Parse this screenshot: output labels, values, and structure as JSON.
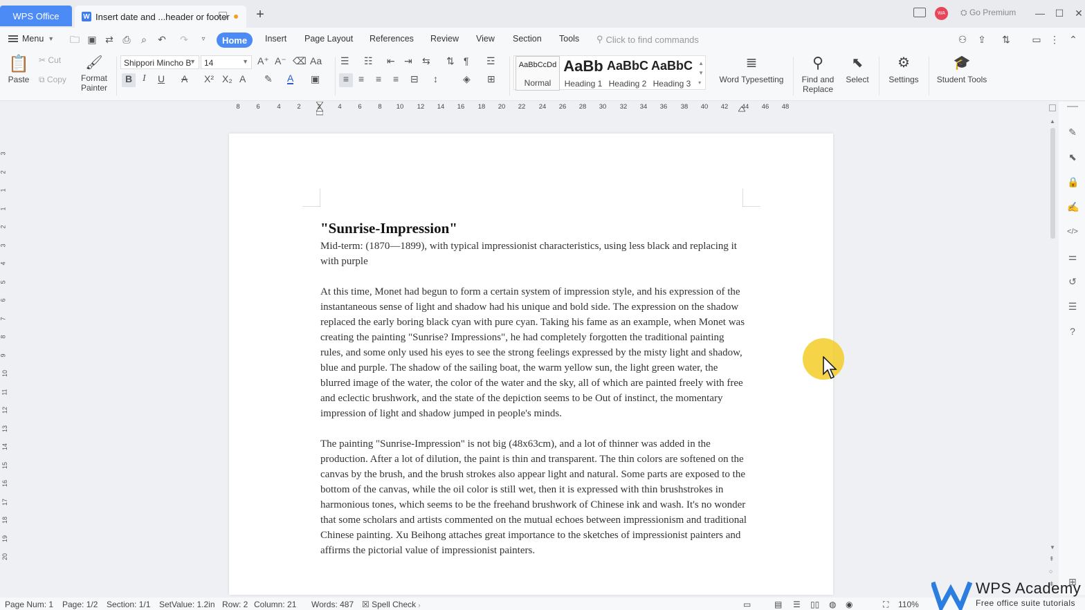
{
  "titlebar": {
    "app_name": "WPS Office",
    "doc_tab": "Insert date and ...header or footer",
    "new_tab": "+",
    "avatar_initials": "WA",
    "go_premium": "Go Premium"
  },
  "menubar": {
    "menu_label": "Menu",
    "tabs": [
      "Home",
      "Insert",
      "Page Layout",
      "References",
      "Review",
      "View",
      "Section",
      "Tools"
    ],
    "active_tab": "Home",
    "search_placeholder": "Click to find commands"
  },
  "ribbon": {
    "paste": "Paste",
    "cut": "Cut",
    "copy": "Copy",
    "format_painter_1": "Format",
    "format_painter_2": "Painter",
    "font_name": "Shippori Mincho B",
    "font_size": "14",
    "styles": [
      {
        "preview": "AaBbCcDd",
        "name": "Normal"
      },
      {
        "preview": "AaBb",
        "name": "Heading 1"
      },
      {
        "preview": "AaBbC",
        "name": "Heading 2"
      },
      {
        "preview": "AaBbC",
        "name": "Heading 3"
      }
    ],
    "word_typesetting": "Word Typesetting",
    "find_replace_1": "Find and",
    "find_replace_2": "Replace",
    "select": "Select",
    "settings": "Settings",
    "student_tools": "Student Tools"
  },
  "ruler": {
    "ticks": [
      "8",
      "6",
      "4",
      "2",
      "2",
      "4",
      "6",
      "8",
      "10",
      "12",
      "14",
      "16",
      "18",
      "20",
      "22",
      "24",
      "26",
      "28",
      "30",
      "32",
      "34",
      "36",
      "38",
      "40",
      "42",
      "44",
      "46",
      "48"
    ],
    "vticks": [
      "3",
      "2",
      "1",
      "1",
      "2",
      "3",
      "4",
      "5",
      "6",
      "7",
      "8",
      "9",
      "10",
      "11",
      "12",
      "13",
      "14",
      "15",
      "16",
      "17",
      "18",
      "19",
      "20"
    ]
  },
  "document": {
    "title": "\"Sunrise-Impression\"",
    "paragraphs": [
      "Mid-term: (1870—1899), with typical impressionist characteristics, using less black and replacing it with purple",
      "At this time, Monet had begun to form a certain system of impression style, and his expression of the instantaneous sense of light and shadow had his unique and bold side. The expression on the shadow replaced the early boring black cyan with pure cyan. Taking his fame as an example, when Monet was creating the painting \"Sunrise? Impressions\", he had completely forgotten the traditional painting rules, and some only used his eyes to see the strong feelings expressed by the misty light and shadow, blue and purple. The shadow of the sailing boat, the warm yellow sun, the light green water, the blurred image of the water, the color of the water and the sky, all of which are painted freely with free and eclectic brushwork, and the state of the depiction seems to be Out of instinct, the momentary impression of light and shadow jumped in people's minds.",
      "The painting \"Sunrise-Impression\" is not big (48x63cm), and a lot of thinner was added in the production. After a lot of dilution, the paint is thin and transparent. The thin colors are softened on the canvas by the brush, and the brush strokes also appear light and natural. Some parts are exposed to the bottom of the canvas, while the oil color is still wet, then it is expressed with thin brushstrokes in harmonious tones, which seems to be the freehand brushwork of Chinese ink and wash. It's no wonder that some scholars and artists commented on the mutual echoes between impressionism and traditional Chinese painting. Xu Beihong attaches great importance to the sketches of impressionist painters and affirms the pictorial value of impressionist painters."
    ]
  },
  "statusbar": {
    "page_num": "Page Num: 1",
    "page": "Page: 1/2",
    "section": "Section: 1/1",
    "set_value": "SetValue: 1.2in",
    "row": "Row: 2",
    "column": "Column: 21",
    "words": "Words: 487",
    "spell_check": "Spell Check",
    "zoom": "110%"
  },
  "watermark": {
    "title": "WPS Academy",
    "subtitle": "Free office suite tutorials"
  },
  "colors": {
    "accent": "#4c8bf5",
    "cursor_highlight": "#f5cd28"
  }
}
